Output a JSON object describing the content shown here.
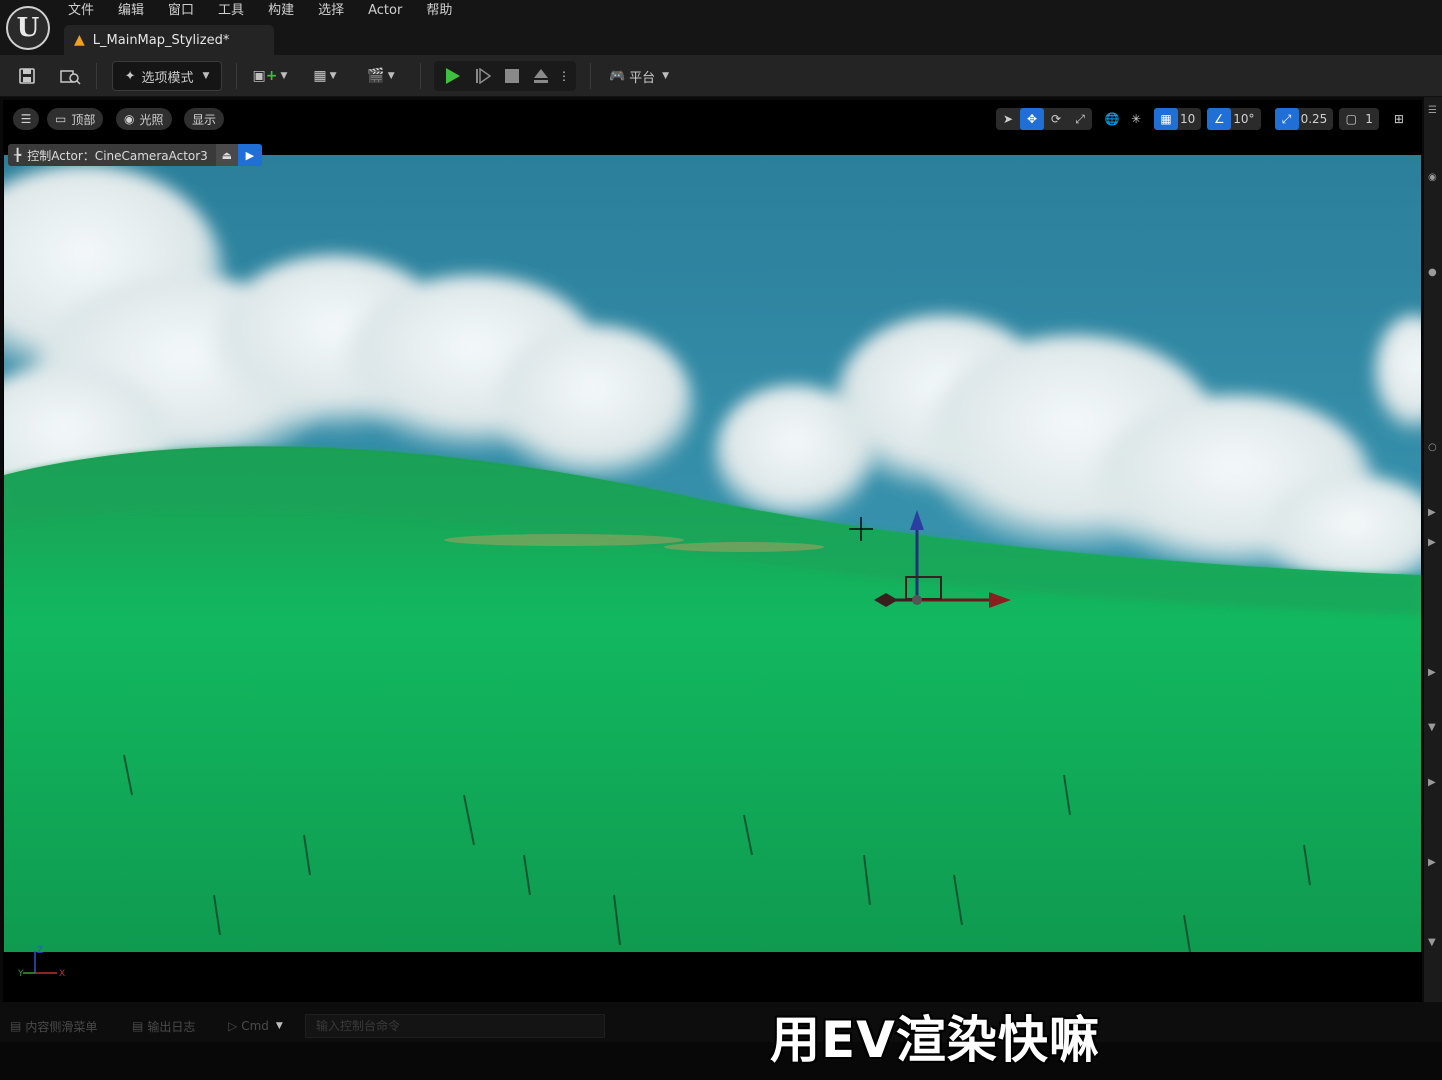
{
  "app": {
    "logo_letter": "U",
    "menu": [
      "文件",
      "编辑",
      "窗口",
      "工具",
      "构建",
      "选择",
      "Actor",
      "帮助"
    ],
    "document_tab": "L_MainMap_Stylized*"
  },
  "toolbar": {
    "mode_label": "选项模式",
    "platform_label": "平台"
  },
  "viewport": {
    "view_label": "顶部",
    "lighting_label": "光照",
    "show_label": "显示",
    "grid_snap": "10",
    "rotation_snap": "10°",
    "scale_snap": "0.25",
    "camera_speed": "1",
    "pilot_label": "控制Actor：CineCameraActor3",
    "axis_z": "Z",
    "axis_y": "Y",
    "axis_x": "X"
  },
  "bottom": {
    "content_drawer": "内容侧滑菜单",
    "output_log": "输出日志",
    "cmd": "Cmd",
    "console_placeholder": "输入控制台命令"
  },
  "overlay": {
    "subtitle": "用EV渲染快嘛"
  },
  "colors": {
    "accent": "#1f6fd6",
    "play_green": "#3fbf3f",
    "sky": "#2f8aa8",
    "grass": "#12b35e"
  }
}
